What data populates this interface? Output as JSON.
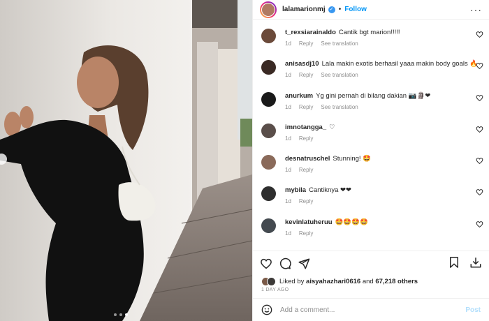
{
  "post": {
    "author": "lalamarionmj",
    "follow_label": "Follow",
    "dot": "•",
    "more": "···"
  },
  "media": {
    "dots": 3,
    "active_dot": 2
  },
  "comments": [
    {
      "username": "t_rexsiarainaldo",
      "text": "Cantik bgt marion!!!!!",
      "age": "1d",
      "reply": "Reply",
      "translate": "See translation",
      "avatar_color": "#6b4a3a"
    },
    {
      "username": "anisasdj10",
      "text": "Lala makin exotis berhasil yaaa makin body goals 🔥",
      "age": "1d",
      "reply": "Reply",
      "translate": "See translation",
      "avatar_color": "#3a2a24"
    },
    {
      "username": "anurkum",
      "text": "Yg gini pernah di bilang dakian 📷🗿❤",
      "age": "1d",
      "reply": "Reply",
      "translate": "See translation",
      "avatar_color": "#1a1a1a"
    },
    {
      "username": "imnotangga_",
      "text": "♡",
      "age": "1d",
      "reply": "Reply",
      "translate": "",
      "avatar_color": "#5a4e4a"
    },
    {
      "username": "desnatruschel",
      "text": "Stunning! 🤩",
      "age": "1d",
      "reply": "Reply",
      "translate": "",
      "avatar_color": "#8a6a5a"
    },
    {
      "username": "mybila",
      "text": "Cantiknya ❤❤",
      "age": "1d",
      "reply": "Reply",
      "translate": "",
      "avatar_color": "#2e2e2e"
    },
    {
      "username": "kevinlatuheruu",
      "text": "🤩🤩🤩🤩",
      "age": "1d",
      "reply": "Reply",
      "translate": "",
      "avatar_color": "#444a50"
    }
  ],
  "likes": {
    "prefix": "Liked by",
    "user": "aisyahazhari0616",
    "joiner": "and",
    "count": "67,218 others"
  },
  "timestamp": "1 DAY AGO",
  "composer": {
    "placeholder": "Add a comment...",
    "post_label": "Post"
  },
  "colors": {
    "accent": "#0095f6",
    "post_disabled": "#b2dffc",
    "meta_gray": "#8e8e8e"
  }
}
